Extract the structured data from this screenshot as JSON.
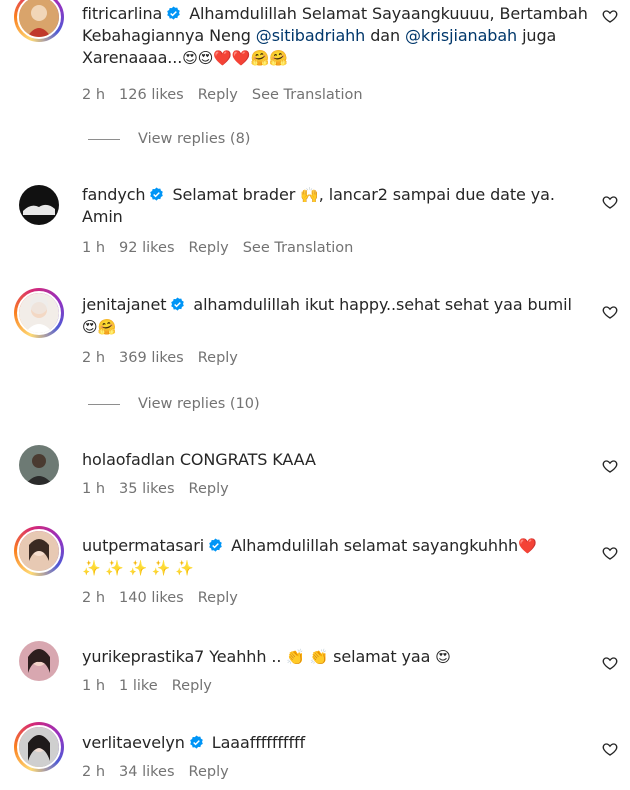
{
  "comments": [
    {
      "username": "fitricarlina",
      "verified": true,
      "text1": "Alhamdulillah Selamat Sayaangkuuuu, Bertambah Kebahagiannya Neng ",
      "mention1": "@sitibadriahh",
      "text2": " dan ",
      "mention2": "@krisjianabah",
      "text3": " juga Xarenaaaa...",
      "emojis": "😍😍❤️❤️🤗🤗",
      "time": "2 h",
      "likes": "126 likes",
      "reply": "Reply",
      "translate": "See Translation",
      "view_replies": "View replies (8)"
    },
    {
      "username": "fandych",
      "verified": true,
      "text1": "Selamat brader ",
      "emoji1": "🙌",
      "text2": ", lancar2 sampai due date ya. Amin",
      "time": "1 h",
      "likes": "92 likes",
      "reply": "Reply",
      "translate": "See Translation"
    },
    {
      "username": "jenitajanet",
      "verified": true,
      "text1": "alhamdulillah ikut happy..sehat sehat yaa bumil",
      "emojis": "😍🤗",
      "time": "2 h",
      "likes": "369 likes",
      "reply": "Reply",
      "view_replies": "View replies (10)"
    },
    {
      "username": "holaofadlan",
      "verified": false,
      "text1": "CONGRATS KAAA",
      "time": "1 h",
      "likes": "35 likes",
      "reply": "Reply"
    },
    {
      "username": "uutpermatasari",
      "verified": true,
      "text1": "Alhamdulillah selamat sayangkuhhh",
      "emoji1": "❤️",
      "emojis": "✨ ✨ ✨ ✨ ✨",
      "time": "2 h",
      "likes": "140 likes",
      "reply": "Reply"
    },
    {
      "username": "yurikeprastika7",
      "verified": false,
      "text1": "Yeahhh .. ",
      "emoji1": "👏 👏",
      "text2": " selamat yaa ",
      "emoji2": "😍",
      "time": "1 h",
      "likes": "1 like",
      "reply": "Reply"
    },
    {
      "username": "verlitaevelyn",
      "verified": true,
      "text1": "Laaaffffffffff",
      "time": "2 h",
      "likes": "34 likes",
      "reply": "Reply"
    }
  ],
  "icons": {
    "verified": "verified-badge-icon",
    "heart": "heart-outline-icon"
  },
  "colors": {
    "verified": "#0095f6",
    "mention": "#00376b",
    "meta": "#737373"
  }
}
